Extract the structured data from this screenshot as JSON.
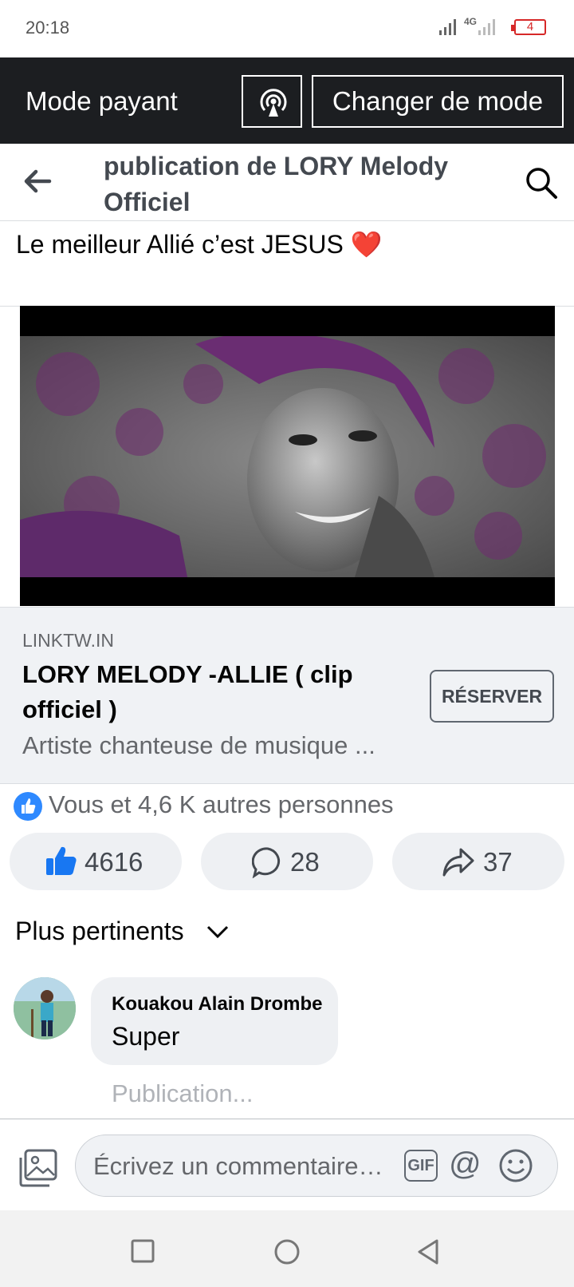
{
  "status_bar": {
    "time": "20:18",
    "network": "4G",
    "battery": "4"
  },
  "mode_bar": {
    "label": "Mode payant",
    "change_button": "Changer de mode",
    "cast_icon": "broadcast-icon"
  },
  "header": {
    "title": "publication de LORY Melody Officiel",
    "back_icon": "arrow-left-icon",
    "search_icon": "search-icon"
  },
  "post": {
    "text_line": "Le meilleur Allié c’est JESUS ❤️"
  },
  "link_card": {
    "domain": "LINKTW.IN",
    "title": "LORY MELODY -ALLIE ( clip officiel )",
    "description": "Artiste chanteuse de musique ...",
    "button": "RÉSERVER"
  },
  "reactions": {
    "summary": "Vous et 4,6 K autres personnes"
  },
  "actions": {
    "likes": "4616",
    "comments": "28",
    "shares": "37"
  },
  "sort": {
    "label": "Plus pertinents"
  },
  "comments": [
    {
      "author": "Kouakou Alain Drombe",
      "text": "Super",
      "status": "Publication..."
    }
  ],
  "composer": {
    "placeholder": "Écrivez un commentaire…",
    "gif": "GIF",
    "at": "@"
  },
  "colors": {
    "brand_blue": "#1877f2",
    "mode_bar_bg": "#1c1e21",
    "card_bg": "#f0f2f5"
  }
}
